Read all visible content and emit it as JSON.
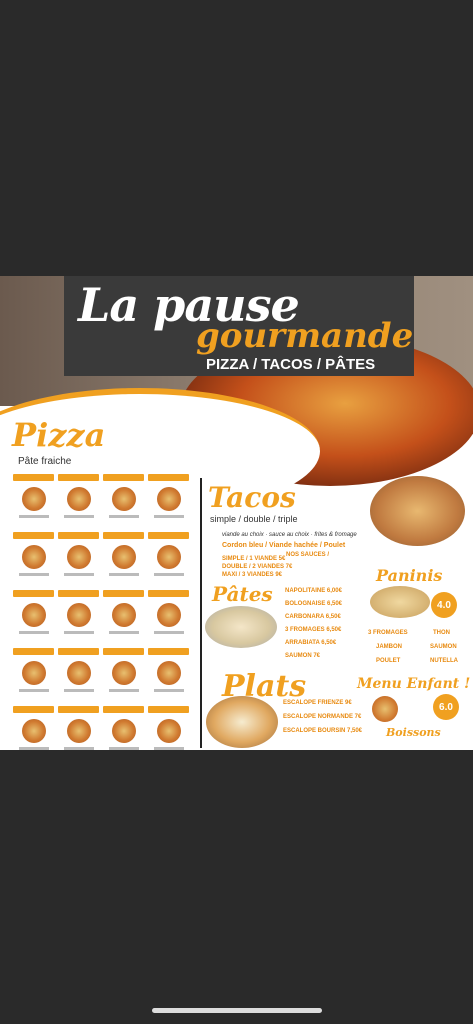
{
  "flyer": {
    "brand_line1": "La pause",
    "brand_line2": "gourmande",
    "tagline": "PIZZA / TACOS / PÂTES",
    "pizza_title": "Pizza",
    "pizza_sub": "Pâte fraiche",
    "tacos_title": "Tacos",
    "tacos_sub": "simple / double / triple",
    "tacos_info": "viande au choix · sauce au choix · frites & fromage",
    "tacos_viandes": "Cordon bleu / Viande hachée / Poulet",
    "tacos_simple": "SIMPLE / 1 VIANDE 5€",
    "tacos_double": "DOUBLE / 2 VIANDES 7€",
    "tacos_maxi": "MAXI / 3 VIANDES 9€",
    "sauces_title": "NOS SAUCES /",
    "pates_title": "Pâtes",
    "pates_items": [
      "NAPOLITAINE 6,00€",
      "BOLOGNAISE 6,50€",
      "CARBONARA 6,50€",
      "3 FROMAGES 6,50€",
      "ARRABIATA 6,50€",
      "SAUMON 7€"
    ],
    "paninis_title": "Paninis",
    "paninis_price": "4.0",
    "paninis_items": [
      "3 FROMAGES",
      "THON",
      "JAMBON",
      "SAUMON",
      "POULET",
      "NUTELLA"
    ],
    "plats_title": "Plats",
    "plats_items": [
      "ESCALOPE FRIENZE 9€",
      "ESCALOPE NORMANDE 7€",
      "ESCALOPE BOURSIN 7,50€"
    ],
    "menu_enfant_title": "Menu Enfant !",
    "menu_enfant_price": "6.0",
    "boissons_title": "Boissons",
    "colors": {
      "accent": "#f0a020",
      "banner": "#3a3a3a",
      "background": "#2a2a2a"
    }
  }
}
